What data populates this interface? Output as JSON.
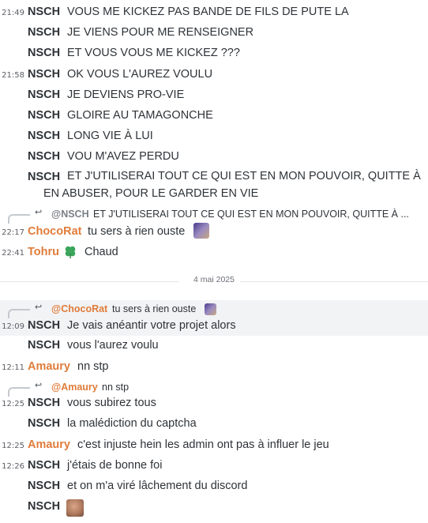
{
  "messages": [
    {
      "time": "21:49",
      "author": "NSCH",
      "text": "VOUS ME KICKEZ PAS BANDE DE FILS DE PUTE LA"
    },
    {
      "time": "",
      "author": "NSCH",
      "text": "JE VIENS POUR ME RENSEIGNER"
    },
    {
      "time": "",
      "author": "NSCH",
      "text": "ET VOUS VOUS ME KICKEZ ???"
    },
    {
      "time": "21:58",
      "author": "NSCH",
      "text": "OK VOUS L'AUREZ VOULU"
    },
    {
      "time": "",
      "author": "NSCH",
      "text": "JE DEVIENS PRO-VIE"
    },
    {
      "time": "",
      "author": "NSCH",
      "text": "GLOIRE AU TAMAGONCHE"
    },
    {
      "time": "",
      "author": "NSCH",
      "text": "LONG VIE À LUI"
    },
    {
      "time": "",
      "author": "NSCH",
      "text": "VOU M'AVEZ PERDU"
    },
    {
      "time": "",
      "author": "NSCH",
      "text": "ET J'UTILISERAI TOUT CE QUI EST EN MON POUVOIR, QUITTE À EN ABUSER, POUR LE GARDER EN VIE"
    },
    {
      "reply_name": "@NSCH",
      "reply_text": "ET J'UTILISERAI TOUT CE QUI EST EN MON POUVOIR, QUITTE À ...",
      "time": "22:17",
      "author": "ChocoRat",
      "text": "tu sers à rien ouste",
      "emoji": "face-photo-emoji"
    },
    {
      "time": "22:41",
      "author": "Tohru",
      "author_icon": "four-leaf-clover-icon",
      "text": "Chaud"
    },
    {
      "divider": "4 mai 2025"
    },
    {
      "reply_name": "@ChocoRat",
      "reply_text": "tu sers à rien ouste",
      "time": "12:09",
      "author": "NSCH",
      "text": "Je vais anéantir votre projet alors"
    },
    {
      "time": "",
      "author": "NSCH",
      "text": "vous l'aurez voulu"
    },
    {
      "time": "12:11",
      "author": "Amaury",
      "text": "nn stp"
    },
    {
      "reply_name": "@Amaury",
      "reply_text": "nn stp",
      "time": "12:25",
      "author": "NSCH",
      "text": "vous subirez tous"
    },
    {
      "time": "",
      "author": "NSCH",
      "text": "la malédiction du captcha"
    },
    {
      "time": "12:25",
      "author": "Amaury",
      "text": "c'est injuste hein les admin ont pas à influer le jeu"
    },
    {
      "time": "12:26",
      "author": "NSCH",
      "text": "j'étais de bonne foi"
    },
    {
      "time": "",
      "author": "NSCH",
      "text": "et on m'a viré lâchement du discord"
    },
    {
      "time": "",
      "author": "NSCH",
      "text": "",
      "emoji": "face-photo-emoji"
    }
  ],
  "colors": {
    "accent_author": "#e07c3a",
    "default_author": "#2e3338",
    "reply_name": "#7a7f86",
    "highlight_bg": "#f2f3f5",
    "clover": "#3ba55c"
  }
}
